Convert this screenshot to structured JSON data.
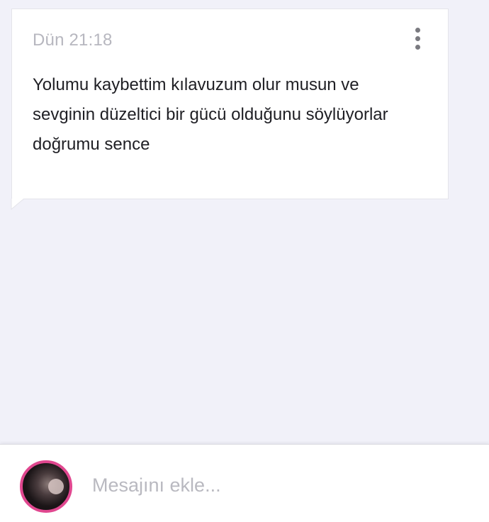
{
  "message": {
    "timestamp": "Dün 21:18",
    "lines": [
      "Yolumu kaybettim kılavuzum olur musun ve",
      "sevginin düzeltici bir gücü olduğunu söylüyorlar",
      "doğrumu sence"
    ],
    "menu_icon": "more-vertical-icon"
  },
  "composer": {
    "avatar_icon": "user-avatar",
    "placeholder": "Mesajını ekle...",
    "value": ""
  },
  "colors": {
    "background": "#f1f1f9",
    "bubble": "#ffffff",
    "avatar_ring": "#e0478f",
    "timestamp": "#b7b7bf",
    "placeholder": "#b9b9c0"
  }
}
